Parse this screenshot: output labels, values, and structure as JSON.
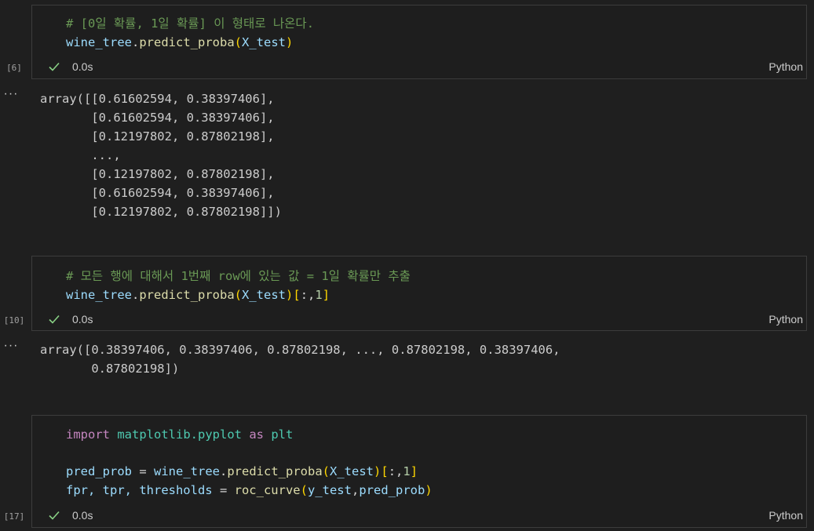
{
  "cells": [
    {
      "exec_count": "[6]",
      "status": "0.0s",
      "language": "Python",
      "code": {
        "l1_comment": "# [0일 확률, 1일 확률] 이 형태로 나온다.",
        "l2_var": "wine_tree",
        "l2_dot": ".",
        "l2_fn": "predict_proba",
        "l2_open": "(",
        "l2_arg": "X_test",
        "l2_close": ")"
      },
      "output": {
        "lines": [
          "array([[0.61602594, 0.38397406],",
          "       [0.61602594, 0.38397406],",
          "       [0.12197802, 0.87802198],",
          "       ...,",
          "       [0.12197802, 0.87802198],",
          "       [0.61602594, 0.38397406],",
          "       [0.12197802, 0.87802198]])"
        ]
      }
    },
    {
      "exec_count": "[10]",
      "status": "0.0s",
      "language": "Python",
      "code": {
        "l1_comment": "# 모든 행에 대해서 1번째 row에 있는 값 = 1일 확률만 추출",
        "l2_var": "wine_tree",
        "l2_dot": ".",
        "l2_fn": "predict_proba",
        "l2_open": "(",
        "l2_arg": "X_test",
        "l2_close": ")",
        "l2_idx_open": "[",
        "l2_idx": ":,",
        "l2_idx_num": "1",
        "l2_idx_close": "]"
      },
      "output": {
        "lines": [
          "array([0.38397406, 0.38397406, 0.87802198, ..., 0.87802198, 0.38397406,",
          "       0.87802198])"
        ]
      }
    },
    {
      "exec_count": "[17]",
      "status": "0.0s",
      "language": "Python",
      "code": {
        "l1_kw1": "import",
        "l1_mod": "matplotlib.pyplot",
        "l1_kw2": "as",
        "l1_alias": "plt",
        "l3_var": "pred_prob",
        "l3_eq": " = ",
        "l3_obj": "wine_tree",
        "l3_dot": ".",
        "l3_fn": "predict_proba",
        "l3_open": "(",
        "l3_arg": "X_test",
        "l3_close": ")",
        "l3_idx_open": "[",
        "l3_idx": ":,",
        "l3_idx_num": "1",
        "l3_idx_close": "]",
        "l4_vars": "fpr, tpr, thresholds",
        "l4_eq": " = ",
        "l4_fn": "roc_curve",
        "l4_open": "(",
        "l4_arg1": "y_test",
        "l4_comma": ",",
        "l4_arg2": "pred_prob",
        "l4_close": ")"
      }
    }
  ],
  "output_marker": "···",
  "colors": {
    "background": "#1f1f1f",
    "cell_bg": "#1e1e1e",
    "cell_border": "#3c3c3c",
    "success_check": "#89d185",
    "comment": "#6a9955",
    "variable": "#9cdcfe",
    "function": "#dcdcaa",
    "keyword": "#c586c0",
    "bracket_level1": "#ffd700",
    "bracket_level2": "#da70d6"
  },
  "icons": {
    "status": "check-icon",
    "output_menu": "ellipsis-icon"
  }
}
